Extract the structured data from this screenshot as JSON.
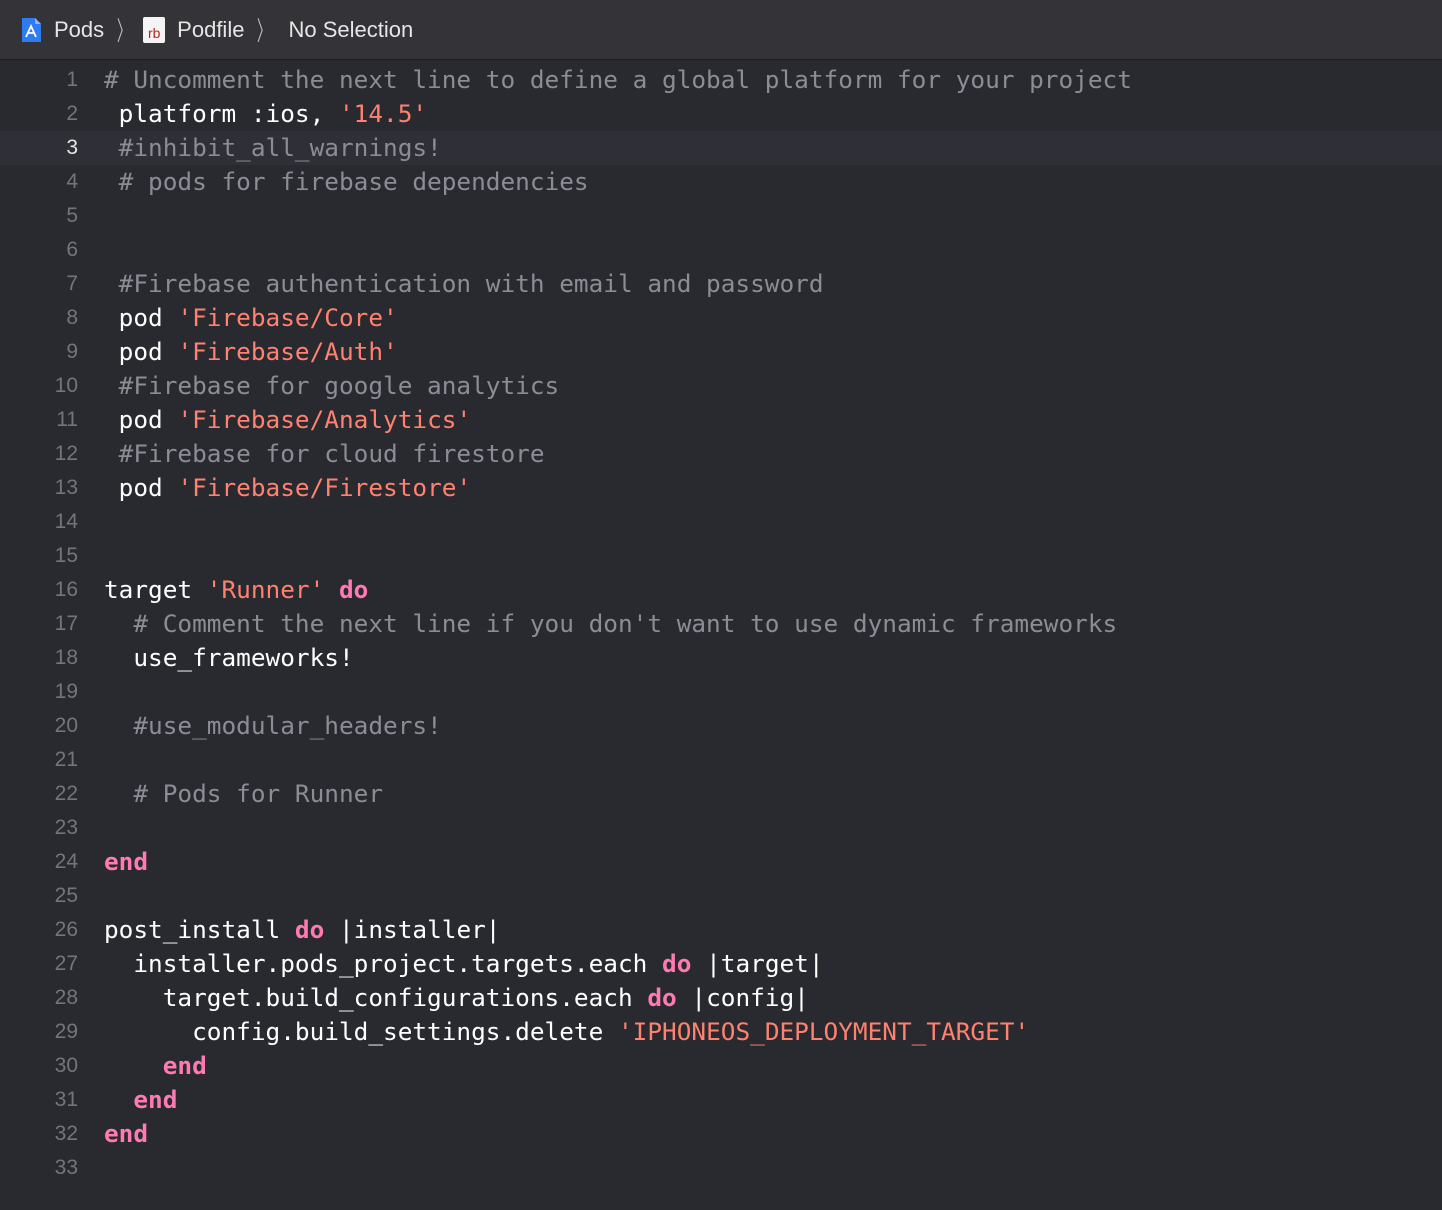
{
  "jumpbar": {
    "crumbs": [
      {
        "label": "Pods",
        "icon": "xcode-project-icon"
      },
      {
        "label": "Podfile",
        "icon": "ruby-file-icon",
        "icon_text": "rb"
      }
    ],
    "selection": "No Selection"
  },
  "editor": {
    "current_line": 3,
    "colors": {
      "background": "#292a30",
      "comment": "#8b8d96",
      "string": "#ff8170",
      "keyword": "#ff7ab2",
      "plain": "#ffffff",
      "line_number": "#74757c"
    },
    "lines": [
      [
        [
          "comment",
          "# Uncomment the next line to define a global platform for your project"
        ]
      ],
      [
        [
          "plain",
          " platform :ios, "
        ],
        [
          "string",
          "'14.5'"
        ]
      ],
      [
        [
          "comment",
          " #inhibit_all_warnings!"
        ]
      ],
      [
        [
          "comment",
          " # pods for firebase dependencies"
        ]
      ],
      [],
      [],
      [
        [
          "comment",
          " #Firebase authentication with email and password"
        ]
      ],
      [
        [
          "plain",
          " pod "
        ],
        [
          "string",
          "'Firebase/Core'"
        ]
      ],
      [
        [
          "plain",
          " pod "
        ],
        [
          "string",
          "'Firebase/Auth'"
        ]
      ],
      [
        [
          "comment",
          " #Firebase for google analytics"
        ]
      ],
      [
        [
          "plain",
          " pod "
        ],
        [
          "string",
          "'Firebase/Analytics'"
        ]
      ],
      [
        [
          "comment",
          " #Firebase for cloud firestore"
        ]
      ],
      [
        [
          "plain",
          " pod "
        ],
        [
          "string",
          "'Firebase/Firestore'"
        ]
      ],
      [],
      [],
      [
        [
          "plain",
          "target "
        ],
        [
          "string",
          "'Runner'"
        ],
        [
          "plain",
          " "
        ],
        [
          "keyword",
          "do"
        ]
      ],
      [
        [
          "comment",
          "  # Comment the next line if you don't want to use dynamic frameworks"
        ]
      ],
      [
        [
          "plain",
          "  use_frameworks!"
        ]
      ],
      [],
      [
        [
          "comment",
          "  #use_modular_headers!"
        ]
      ],
      [],
      [
        [
          "comment",
          "  # Pods for Runner"
        ]
      ],
      [],
      [
        [
          "keyword",
          "end"
        ]
      ],
      [],
      [
        [
          "plain",
          "post_install "
        ],
        [
          "keyword",
          "do"
        ],
        [
          "plain",
          " |installer|"
        ]
      ],
      [
        [
          "plain",
          "  installer.pods_project.targets.each "
        ],
        [
          "keyword",
          "do"
        ],
        [
          "plain",
          " |target|"
        ]
      ],
      [
        [
          "plain",
          "    target.build_configurations.each "
        ],
        [
          "keyword",
          "do"
        ],
        [
          "plain",
          " |config|"
        ]
      ],
      [
        [
          "plain",
          "      config.build_settings.delete "
        ],
        [
          "string",
          "'IPHONEOS_DEPLOYMENT_TARGET'"
        ]
      ],
      [
        [
          "plain",
          "    "
        ],
        [
          "keyword",
          "end"
        ]
      ],
      [
        [
          "plain",
          "  "
        ],
        [
          "keyword",
          "end"
        ]
      ],
      [
        [
          "keyword",
          "end"
        ]
      ],
      []
    ]
  }
}
